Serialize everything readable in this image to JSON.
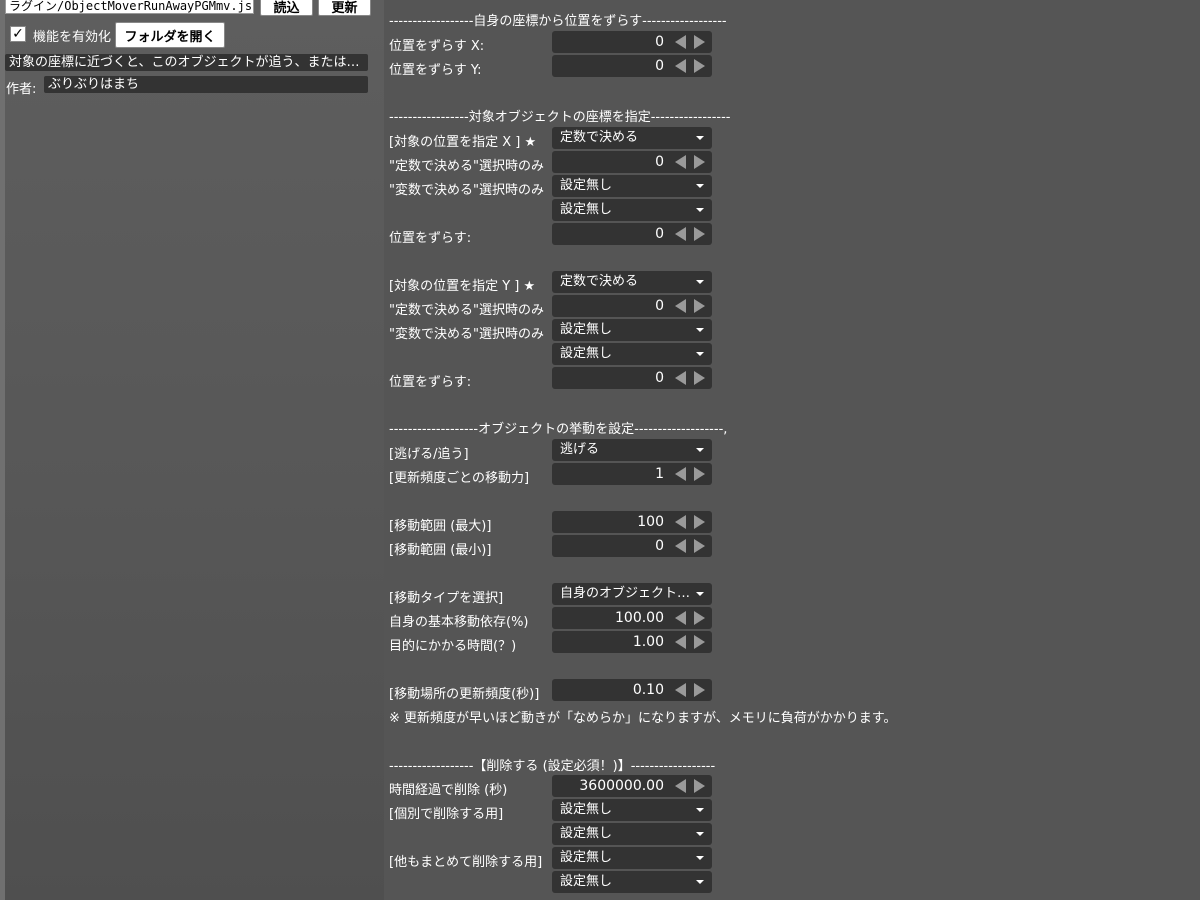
{
  "toolbar": {
    "path_value": "ラグイン/ObjectMoverRunAwayPGMmv.js",
    "load_label": "読込",
    "refresh_label": "更新",
    "enable_label": "機能を有効化",
    "enable_checked": true,
    "open_folder_label": "フォルダを開く"
  },
  "plugin": {
    "description": "対象の座標に近づくと、このオブジェクトが追う、または…",
    "author_label": "作者:",
    "author": "ぶりぶりはまち"
  },
  "sections": {
    "self_offset": "------------------自身の座標から位置をずらす------------------",
    "target": "-----------------対象オブジェクトの座標を指定-----------------",
    "behavior": "-------------------オブジェクトの挙動を設定-------------------,",
    "delete": "------------------【削除する (設定必須！)】------------------"
  },
  "fields": {
    "offset_x_label": "位置をずらす X:",
    "offset_x": "0",
    "offset_y_label": "位置をずらす Y:",
    "offset_y": "0",
    "tx_label": "[対象の位置を指定 X ] ★",
    "tx_mode": "定数で決める",
    "tx_const_label": "\"定数で決める\"選択時のみ",
    "tx_const": "0",
    "tx_var_label": "\"変数で決める\"選択時のみ",
    "tx_var1": "設定無し",
    "tx_var2": "設定無し",
    "tx_shift_label": "位置をずらす:",
    "tx_shift": "0",
    "ty_label": "[対象の位置を指定 Y ] ★",
    "ty_mode": "定数で決める",
    "ty_const_label": "\"定数で決める\"選択時のみ",
    "ty_const": "0",
    "ty_var_label": "\"変数で決める\"選択時のみ",
    "ty_var1": "設定無し",
    "ty_var2": "設定無し",
    "ty_shift_label": "位置をずらす:",
    "ty_shift": "0",
    "flee_label": "[逃げる/追う]",
    "flee_mode": "逃げる",
    "move_power_label": "[更新頻度ごとの移動力]",
    "move_power": "1",
    "range_max_label": "[移動範囲 (最大)]",
    "range_max": "100",
    "range_min_label": "[移動範囲 (最小)]",
    "range_min": "0",
    "move_type_label": "[移動タイプを選択]",
    "move_type": "自身のオブジェクト…",
    "base_dep_label": "自身の基本移動依存(%)",
    "base_dep": "100.00",
    "time_label": "目的にかかる時間(？)",
    "time": "1.00",
    "update_freq_label": "[移動場所の更新頻度(秒)]",
    "update_freq": "0.10",
    "update_note": "※ 更新頻度が早いほど動きが「なめらか」になりますが、メモリに負荷がかかります。",
    "del_time_label": "時間経過で削除 (秒)",
    "del_time": "3600000.00",
    "del_individual_label": "[個別で削除する用]",
    "del_individual1": "設定無し",
    "del_individual2": "設定無し",
    "del_all_label": "[他もまとめて削除する用]",
    "del_all1": "設定無し",
    "del_all2": "設定無し"
  }
}
